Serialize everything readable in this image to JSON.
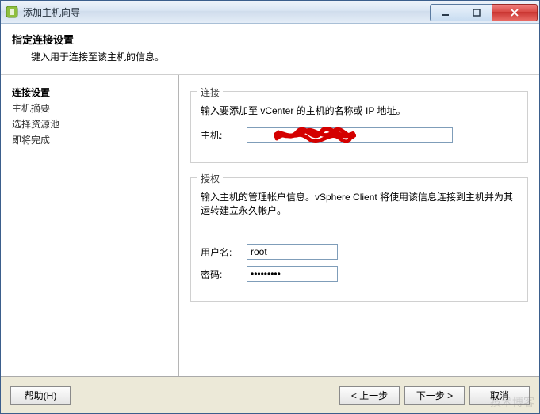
{
  "window": {
    "title": "添加主机向导"
  },
  "header": {
    "title": "指定连接设置",
    "subtitle": "键入用于连接至该主机的信息。"
  },
  "nav": {
    "steps": [
      {
        "label": "连接设置",
        "current": true
      },
      {
        "label": "主机摘要",
        "current": false
      },
      {
        "label": "选择资源池",
        "current": false
      },
      {
        "label": "即将完成",
        "current": false
      }
    ]
  },
  "connection": {
    "legend": "连接",
    "instruction": "输入要添加至 vCenter 的主机的名称或 IP 地址。",
    "host_label": "主机:",
    "host_value": ""
  },
  "auth": {
    "legend": "授权",
    "instruction": "输入主机的管理帐户信息。vSphere Client 将使用该信息连接到主机并为其运转建立永久帐户。",
    "user_label": "用户名:",
    "user_value": "root",
    "pass_label": "密码:",
    "pass_value": "*********"
  },
  "footer": {
    "help": "帮助(H)",
    "back": "< 上一步",
    "next": "下一步 >",
    "cancel": "取消"
  },
  "watermark": "技术博客"
}
